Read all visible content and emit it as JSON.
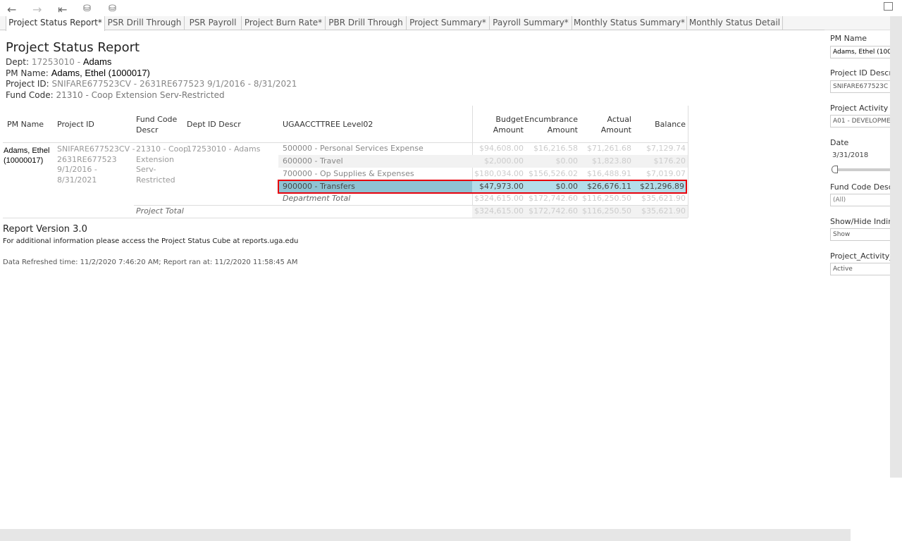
{
  "toolbar": {
    "icons": [
      "back-icon",
      "forward-icon",
      "first-page-icon",
      "refresh-data-icon",
      "pause-updates-icon",
      "fullscreen-icon"
    ]
  },
  "tabs": [
    "Project Status Report*",
    "PSR Drill Through",
    "PSR Payroll",
    "Project Burn Rate*",
    "PBR Drill Through",
    "Project Summary*",
    "Payroll Summary*",
    "Monthly Status Summary*",
    "Monthly Status Detail"
  ],
  "report": {
    "title": "Project Status Report",
    "dept_label": "Dept:",
    "dept_code": "17253010 -",
    "dept_name": "Adams",
    "pm_label": "PM Name:",
    "pm_value": "Adams, Ethel (1000017)",
    "project_label": "Project ID:",
    "project_value": "SNIFARE677523CV - 2631RE677523 9/1/2016 - 8/31/2021",
    "fund_label": "Fund Code:",
    "fund_value": "21310 - Coop Extension Serv-Restricted"
  },
  "table": {
    "headers": {
      "pm": "PM Name",
      "project": "Project ID",
      "fund1": "Fund Code",
      "fund2": "Descr",
      "dept": "Dept ID Descr",
      "level": "UGAACCTTREE Level02",
      "budget1": "Budget",
      "budget2": "Amount",
      "enc1": "Encumbrance",
      "enc2": "Amount",
      "actual1": "Actual",
      "actual2": "Amount",
      "balance": "Balance"
    },
    "pm": [
      "Adams, Ethel",
      "(10000017)"
    ],
    "project": [
      "SNIFARE677523CV -",
      "2631RE677523",
      "9/1/2016 -",
      "8/31/2021"
    ],
    "fund": [
      "21310 - Coop",
      "Extension",
      "Serv-",
      "Restricted"
    ],
    "dept": "17253010 - Adams",
    "rows": [
      {
        "label": "500000 - Personal Services Expense",
        "budget": "$94,608.00",
        "enc": "$16,216.58",
        "actual": "$71,261.68",
        "balance": "$7,129.74"
      },
      {
        "label": "600000 - Travel",
        "budget": "$2,000.00",
        "enc": "$0.00",
        "actual": "$1,823.80",
        "balance": "$176.20"
      },
      {
        "label": "700000 - Op Supplies & Expenses",
        "budget": "$180,034.00",
        "enc": "$156,526.02",
        "actual": "$16,488.91",
        "balance": "$7,019.07"
      },
      {
        "label": "900000 - Transfers",
        "budget": "$47,973.00",
        "enc": "$0.00",
        "actual": "$26,676.11",
        "balance": "$21,296.89"
      },
      {
        "label": "Department Total",
        "budget": "$324,615.00",
        "enc": "$172,742.60",
        "actual": "$116,250.50",
        "balance": "$35,621.90"
      }
    ],
    "project_total": {
      "label": "Project Total",
      "budget": "$324,615.00",
      "enc": "$172,742.60",
      "actual": "$116,250.50",
      "balance": "$35,621.90"
    }
  },
  "footer": {
    "version": "Report Version 3.0",
    "info": "For additional information please access the Project Status Cube at reports.uga.edu",
    "refresh": "Data Refreshed time: 11/2/2020 7:46:20 AM; Report ran at: 11/2/2020 11:58:45 AM"
  },
  "filters": {
    "pm_label": "PM Name",
    "pm_value": "Adams, Ethel (100",
    "projid_label": "Project ID Descr",
    "projid_value": "SNIFARE677523C",
    "activity_label": "Project Activity I",
    "activity_value": "A01 - DEVELOPME",
    "date_label": "Date",
    "date_value": "3/31/2018",
    "fund_label": "Fund Code Descr",
    "fund_value": "(All)",
    "indirect_label": "Show/Hide Indire",
    "indirect_value": "Show",
    "status_label": "Project_Activity_",
    "status_value": "Active"
  },
  "colors": {
    "highlight": "#b3dde9",
    "highlight_border": "#e8000b"
  }
}
